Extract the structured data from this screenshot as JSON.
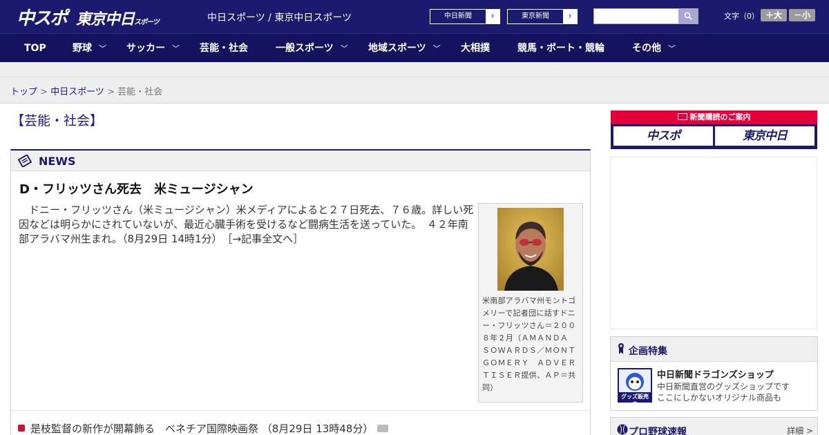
{
  "header": {
    "logo_chuspo": "中スポ",
    "logo_tokyo": "東京中日",
    "logo_tokyo_small": "スポーツ",
    "site_name": "中日スポーツ / 東京中日スポーツ",
    "btn_chunichi": "中日新聞",
    "btn_tokyo": "東京新聞",
    "font_label": "文字（0）",
    "font_bigger": "＋大",
    "font_smaller": "－小"
  },
  "nav": {
    "items": [
      {
        "label": "TOP"
      },
      {
        "label": "野球",
        "has_menu": true
      },
      {
        "label": "サッカー",
        "has_menu": true
      },
      {
        "label": "芸能・社会"
      },
      {
        "label": "一般スポーツ",
        "has_menu": true
      },
      {
        "label": "地域スポーツ",
        "has_menu": true
      },
      {
        "label": "大相撲"
      },
      {
        "label": "競馬・ボート・競輪"
      },
      {
        "label": "その他",
        "has_menu": true
      }
    ]
  },
  "breadcrumb": {
    "home": "トップ",
    "sep": " > ",
    "site": "中日スポーツ",
    "current": "芸能・社会"
  },
  "section_title": "【芸能・社会】",
  "news": {
    "heading": "NEWS",
    "headline": "D・フリッツさん死去　米ミュージシャン",
    "body": "　ドニー・フリッツさん（米ミュージシャン）米メディアによると２７日死去、７６歳。詳しい死因などは明らかにされていないが、最近心臓手術を受けるなど闘病生活を送っていた。　４２年南部アラバマ州生まれ。（8月29日 14時1分）",
    "more_link": "［→記事全文へ］",
    "photo_caption": "米南部アラバマ州モントゴメリーで記者団に話すドニー・フリッツさん＝２００８年２月（ＡＭＡＮＤＡ　ＳＯＷＡＲＤＳ／ＭＯＮＴＧＯＭＥＲＹ　ＡＤＶＥＲＴＩＳＥＲ提供、ＡＰ＝共同）",
    "list": [
      {
        "title": "是枝監督の新作が開幕飾る　ベネチア国際映画祭",
        "time": "（8月29日 13時48分）",
        "has_photo": true
      }
    ]
  },
  "sidebar": {
    "subscribe_title": "新聞購読のご案内",
    "subscribe_chuspo": "中スポ",
    "subscribe_tokyo": "東京中日",
    "feature_title": "企画特集",
    "shop_title": "中日新聞ドラゴンズショップ",
    "shop_desc1": "中日新聞直営のグッズショップです",
    "shop_desc2": "ここにしかないオリジナル商品も",
    "shop_badge": "グッズ販売中",
    "baseball_title": "プロ野球速報",
    "baseball_detail": "詳細 >"
  },
  "colors": {
    "navy": "#1c1a6e",
    "nav_dark": "#151360",
    "accent_red": "#d0122f",
    "subscribe_red": "#e4003a"
  }
}
